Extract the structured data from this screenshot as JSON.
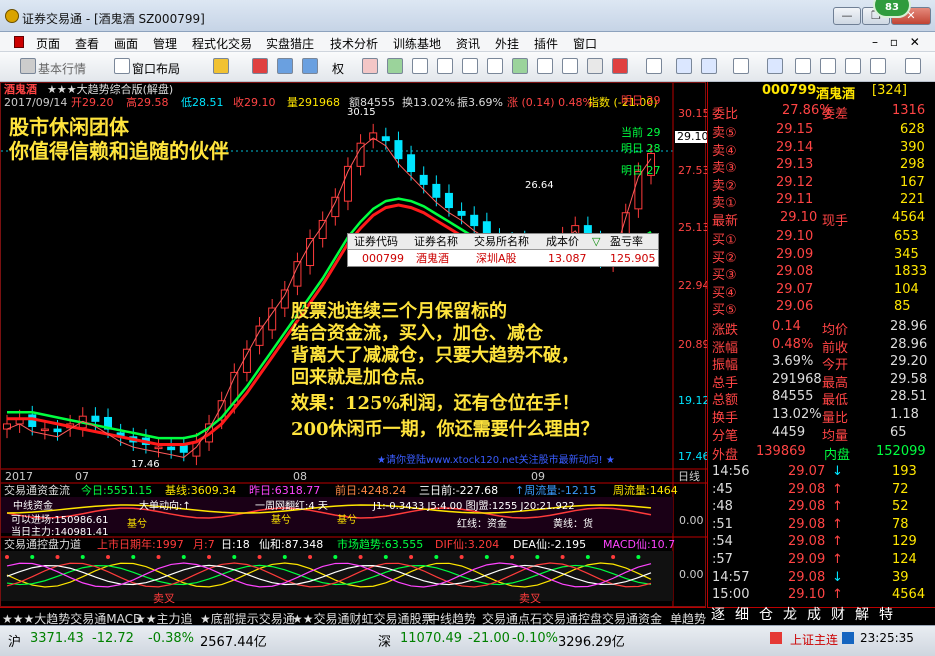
{
  "window": {
    "title": "证券交易通 - [酒鬼酒 SZ000799]",
    "badge": "83",
    "min": "—",
    "restore": "❐",
    "close": "✕"
  },
  "menu": {
    "items": [
      "页面",
      "查看",
      "画面",
      "管理",
      "程式化交易",
      "实盘猎庄",
      "技术分析",
      "训练基地",
      "资讯",
      "外挂",
      "插件",
      "窗口"
    ],
    "right_controls": "– ▫ ✕"
  },
  "toolbar": {
    "left_label": "基本行情",
    "layout_label": "窗口布局",
    "weight_label": "权"
  },
  "chart_header": {
    "stock": "酒鬼酒",
    "indicator": "★★★大趋势综合版(解盘)",
    "date": "2017/09/14",
    "open": "开29.20",
    "high": "高29.58",
    "low": "低28.51",
    "close": "收29.10",
    "volume": "量291968",
    "amount": "额84555",
    "turnover": "换13.02%",
    "amplitude": "振3.69%",
    "change": "涨 (0.14) 0.48%",
    "index": "指数 (-21.00)"
  },
  "overlay": {
    "top_line1": "股市休闲团体",
    "top_line2": "你值得信赖和追随的伙伴",
    "body": [
      "股票池连续三个月保留标的",
      "结合资金流，买入，加仓、减仓",
      "背离大了减减仓，只要大趋势不破，",
      "回来就是加仓点。",
      "效果：125%利润，还有仓位在手！",
      "200休闲币一期，你还需要什么理由？"
    ],
    "watermark": "★请你登陆www.xtock120.net关注股市最新动向! ★",
    "sell_label": "卖叉",
    "sell_label2": "卖叉"
  },
  "position_table": {
    "headers": [
      "证券代码",
      "证券名称",
      "交易所名称",
      "成本价",
      "▽",
      "盈亏率"
    ],
    "row": [
      "000799",
      "酒鬼酒",
      "深圳A股",
      "13.087",
      "",
      "125.905"
    ]
  },
  "chart_data": {
    "type": "line",
    "y_axis_ticks": [
      "30.15",
      "29.10",
      "27.53",
      "25.13",
      "22.94",
      "20.89",
      "19.12",
      "17.46"
    ],
    "ylim": [
      17.46,
      30.15
    ],
    "x_ticks": [
      "2017",
      "07",
      "08",
      "09"
    ],
    "x_label": "日线",
    "annotations": {
      "high_peak": "30.15",
      "mid_peak": "26.64",
      "low_point": "17.46",
      "last_price": "29.10"
    },
    "future_labels": [
      "明日 29",
      "当前 29",
      "明日 28",
      "明日 27"
    ],
    "series": [
      {
        "values": [
          18.6,
          18.8,
          18.5,
          18.4,
          18.3,
          18.6,
          18.9,
          18.7,
          18.4,
          18.1,
          17.9,
          17.8,
          17.7,
          17.6,
          17.5,
          17.9,
          18.6,
          19.5,
          20.6,
          21.5,
          22.4,
          23.1,
          23.8,
          24.9,
          25.8,
          26.5,
          27.4,
          28.6,
          29.5,
          29.9,
          29.6,
          28.9,
          28.4,
          27.9,
          27.4,
          27.0,
          26.7,
          26.3,
          26.0,
          25.7,
          25.6,
          25.5,
          25.4,
          25.6,
          25.9,
          26.3,
          25.6,
          25.0,
          25.2,
          26.8,
          28.4,
          29.1
        ]
      },
      {
        "values": [
          18.8,
          18.8,
          18.8,
          18.7,
          18.6,
          18.5,
          18.4,
          18.3,
          18.2,
          18.1,
          18.0,
          17.9,
          17.8,
          17.8,
          17.8,
          17.9,
          18.2,
          18.6,
          19.2,
          19.8,
          20.5,
          21.2,
          21.9,
          22.6,
          23.3,
          24.0,
          24.8,
          25.6,
          26.2,
          26.7,
          27.0,
          27.1,
          27.0,
          26.8,
          26.5,
          26.2,
          25.9,
          25.6,
          25.4,
          25.2,
          25.1,
          25.0,
          24.9,
          24.9,
          25.0,
          25.1,
          25.1,
          25.0,
          25.0,
          25.2,
          25.5,
          25.8
        ]
      }
    ]
  },
  "sub1": {
    "title": "交易通资金流",
    "today": "今日:5551.15",
    "base": "基线:3609.34",
    "yesterday": "昨日:6318.77",
    "before": "前日:4248.24",
    "three": "三日前:-227.68",
    "mid": "↑周流量:-12.15",
    "flow": "周流量:1464",
    "row2a": "中线资金",
    "row2b": "大单动向:↑",
    "row2c": "一周网翻红:4 天",
    "row2d": "J1:-0.3433 J5:4.00 图J盟:1255 J20:21.922",
    "row3a": "可以进场:150986.61",
    "row3b": "基兮",
    "row3c": "基兮",
    "row3d": "基兮",
    "row3e": "红线：资金",
    "row3f": "黄线：货",
    "row4": "当日主力:140981.41",
    "axis": "0.00"
  },
  "sub2": {
    "title": "交易通控盘力道",
    "fiscal": "上市日期年:1997",
    "month": "月:7",
    "day": "日:18",
    "immortal": "仙和:87.348",
    "trend": "市场趋势:63.555",
    "dif": "DIF仙:3.204",
    "dea": "DEA仙:-2.195",
    "macd": "MACD仙:10.7",
    "axis": "0.00"
  },
  "bottom_tabs": [
    "★★★大趋势交易通MACD",
    "★★主力追",
    "★底部提示交易通",
    "★★交易通财虹交易通股票",
    "中线趋势",
    "交易通点石交易通控盘交易通资金",
    "单趋势"
  ],
  "right_tabs": [
    "逐",
    "细",
    "仓",
    "龙",
    "成",
    "财",
    "解",
    "特"
  ],
  "quote": {
    "code": "000799",
    "name": "酒鬼酒",
    "count": "[324]",
    "weibi_label": "委比",
    "weibi": "27.86%",
    "weicha_label": "委差",
    "weicha": "1316",
    "sells": [
      {
        "label": "卖⑤",
        "price": "29.15",
        "vol": "628"
      },
      {
        "label": "卖④",
        "price": "29.14",
        "vol": "390"
      },
      {
        "label": "卖③",
        "price": "29.13",
        "vol": "298"
      },
      {
        "label": "卖②",
        "price": "29.12",
        "vol": "167"
      },
      {
        "label": "卖①",
        "price": "29.11",
        "vol": "221"
      }
    ],
    "last_label": "最新",
    "last": "29.10",
    "hand_label": "现手",
    "hand": "4564",
    "buys": [
      {
        "label": "买①",
        "price": "29.10",
        "vol": "653"
      },
      {
        "label": "买②",
        "price": "29.09",
        "vol": "345"
      },
      {
        "label": "买③",
        "price": "29.08",
        "vol": "1833"
      },
      {
        "label": "买④",
        "price": "29.07",
        "vol": "104"
      },
      {
        "label": "买⑤",
        "price": "29.06",
        "vol": "85"
      }
    ],
    "stats": [
      {
        "a": "涨跌",
        "av": "0.14",
        "b": "均价",
        "bv": "28.96"
      },
      {
        "a": "涨幅",
        "av": "0.48%",
        "b": "前收",
        "bv": "28.96"
      },
      {
        "a": "振幅",
        "av": "3.69%",
        "b": "今开",
        "bv": "29.20"
      },
      {
        "a": "总手",
        "av": "291968",
        "b": "最高",
        "bv": "29.58"
      },
      {
        "a": "总额",
        "av": "84555",
        "b": "最低",
        "bv": "28.51"
      },
      {
        "a": "换手",
        "av": "13.02%",
        "b": "量比",
        "bv": "1.18"
      },
      {
        "a": "分笔",
        "av": "4459",
        "b": "均量",
        "bv": "65"
      }
    ],
    "outer_label": "外盘",
    "outer": "139869",
    "inner_label": "内盘",
    "inner": "152099",
    "ticks": [
      {
        "t": "14:56",
        "p": "29.07",
        "d": "↓",
        "v": "193"
      },
      {
        "t": ":45",
        "p": "29.08",
        "d": "↑",
        "v": "72"
      },
      {
        "t": ":48",
        "p": "29.08",
        "d": "↑",
        "v": "52"
      },
      {
        "t": ":51",
        "p": "29.08",
        "d": "↑",
        "v": "78"
      },
      {
        "t": ":54",
        "p": "29.08",
        "d": "↑",
        "v": "129"
      },
      {
        "t": ":57",
        "p": "29.09",
        "d": "↑",
        "v": "124"
      },
      {
        "t": "14:57",
        "p": "29.08",
        "d": "↓",
        "v": "39"
      },
      {
        "t": "15:00",
        "p": "29.10",
        "d": "↑",
        "v": "4564"
      }
    ]
  },
  "status": {
    "sh_label": "沪",
    "sh": "3371.43",
    "sh_chg": "-12.72",
    "sh_pct": "-0.38%",
    "sh_amt": "2567.44亿",
    "sz_label": "深",
    "sz": "11070.49",
    "sz_chg": "-21.00",
    "sz_pct": "-0.10%",
    "sz_amt": "3296.29亿",
    "main_link": "上证主连",
    "time": "23:25:35"
  },
  "colors": {
    "up": "#ff3b3b",
    "down": "#00e5ff",
    "yellow": "#ffe600",
    "green": "#00ff40",
    "bg": "#000000",
    "white": "#ffffff"
  }
}
